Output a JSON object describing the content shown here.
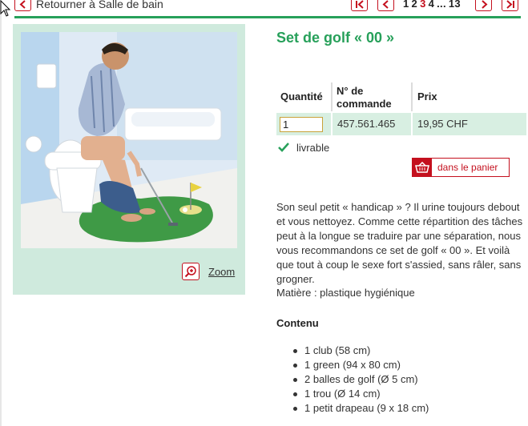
{
  "navigation": {
    "back_label": "Retourner à Salle de bain",
    "pages": [
      "1",
      "2",
      "3",
      "4",
      "...",
      "13"
    ],
    "current_page": "3"
  },
  "product": {
    "title": "Set de golf « 00 »",
    "zoom_label": "Zoom"
  },
  "order": {
    "headers": {
      "quantity": "Quantité",
      "order_number": "N° de commande",
      "price": "Prix"
    },
    "quantity_value": "1",
    "order_number": "457.561.465",
    "price": "19,95 CHF",
    "availability": "livrable",
    "add_to_cart_label": "dans le panier"
  },
  "description": {
    "text": "Son seul petit « handicap » ? Il urine toujours debout et vous nettoyez. Comme cette répartition des tâches peut à la longue se traduire par une séparation, nous vous recommandons ce set de golf « 00 ». Et voilà que tout à coup le sexe fort s'assied, sans râler, sans grogner.",
    "material": "Matière : plastique hygiénique"
  },
  "contents": {
    "title": "Contenu",
    "items": [
      "1 club (58 cm)",
      "1 green (94 x 80 cm)",
      "2 balles de golf (Ø 5 cm)",
      "1 trou (Ø 14 cm)",
      "1 petit drapeau (9 x 18 cm)"
    ]
  },
  "colors": {
    "accent_green": "#27a05a",
    "accent_red": "#c4101e",
    "light_green_bg": "#cfeadd"
  }
}
